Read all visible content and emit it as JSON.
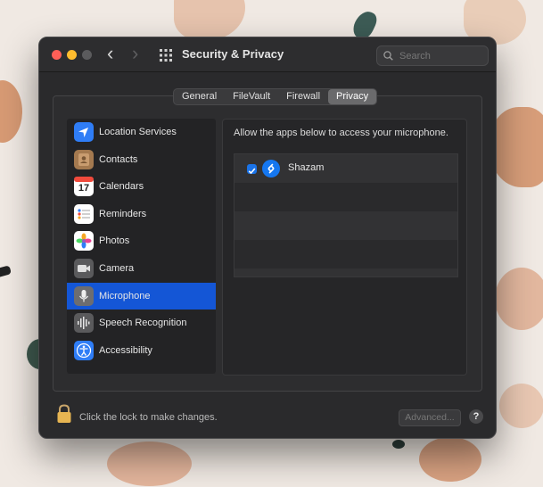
{
  "window": {
    "title": "Security & Privacy",
    "search_placeholder": "Search"
  },
  "tabs": [
    {
      "label": "General",
      "active": false
    },
    {
      "label": "FileVault",
      "active": false
    },
    {
      "label": "Firewall",
      "active": false
    },
    {
      "label": "Privacy",
      "active": true
    }
  ],
  "sidebar": {
    "items": [
      {
        "label": "Location Services",
        "icon": "location-arrow-icon"
      },
      {
        "label": "Contacts",
        "icon": "contacts-book-icon"
      },
      {
        "label": "Calendars",
        "icon": "calendar-icon",
        "date_number": "17"
      },
      {
        "label": "Reminders",
        "icon": "reminders-list-icon"
      },
      {
        "label": "Photos",
        "icon": "photos-flower-icon"
      },
      {
        "label": "Camera",
        "icon": "camera-icon"
      },
      {
        "label": "Microphone",
        "icon": "microphone-icon",
        "selected": true
      },
      {
        "label": "Speech Recognition",
        "icon": "waveform-icon"
      },
      {
        "label": "Accessibility",
        "icon": "accessibility-figure-icon"
      }
    ]
  },
  "main": {
    "prompt": "Allow the apps below to access your microphone.",
    "apps": [
      {
        "name": "Shazam",
        "checked": true,
        "icon": "shazam-icon"
      }
    ]
  },
  "footer": {
    "lock_text": "Click the lock to make changes.",
    "advanced_label": "Advanced...",
    "help_label": "?"
  },
  "colors": {
    "selection_accent": "#1456d6",
    "checkbox_blue": "#1a73e8"
  }
}
